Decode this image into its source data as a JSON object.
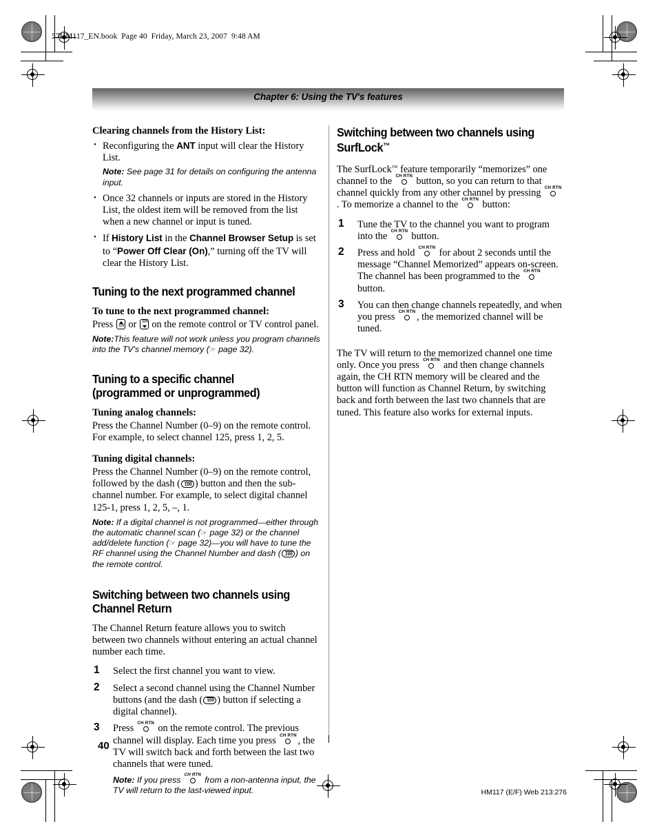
{
  "book_header": "57HM117_EN.book  Page 40  Friday, March 23, 2007  9:48 AM",
  "chapter_banner": {
    "title": "Chapter 6: Using the TV's features"
  },
  "left_column": {
    "history_heading": "Clearing channels from the History List:",
    "history_bullets": {
      "b1_pre": "Reconfiguring the ",
      "b1_bold": "ANT",
      "b1_post": " input will clear the History List.",
      "b1_note_label": "Note:",
      "b1_note_text": " See page 31 for details on configuring the antenna input.",
      "b2": "Once 32 channels or inputs are stored in the History List, the oldest item will be removed from the list when a new channel or input is tuned.",
      "b3_pre": "If ",
      "b3_bold1": "History List",
      "b3_mid1": " in the ",
      "b3_bold2": "Channel Browser Setup",
      "b3_mid2": " is set to “",
      "b3_bold3": "Power Off Clear (On)",
      "b3_post": ",” turning off the TV will clear the History List."
    },
    "section_next_channel": {
      "heading": "Tuning to the next programmed channel",
      "sub": "To tune to the next programmed channel:",
      "body_pre": "Press ",
      "body_mid": " or ",
      "body_post": " on the remote control or TV control panel.",
      "note_label": "Note:",
      "note_pre": "This feature will not work unless you program channels into the TV's channel memory (",
      "note_post": " page 32)."
    },
    "section_specific_channel": {
      "heading": "Tuning to a specific channel (programmed or unprogrammed)",
      "analog_sub": "Tuning analog channels:",
      "analog_body": "Press the Channel Number (0–9) on the remote control. For example, to select channel 125, press 1, 2, 5.",
      "digital_sub": "Tuning digital channels:",
      "digital_pre": "Press the Channel Number (0–9) on the remote control, followed by the dash (",
      "digital_post": ") button and then the sub-channel number. For example, to select digital channel 125-1, press 1, 2, 5, –, 1.",
      "digital_note_label": "Note:",
      "digital_note_p1": " If a digital channel is not programmed—either through the automatic channel scan (",
      "digital_note_p2": " page 32) or the channel add/delete function (",
      "digital_note_p3": " page 32)—you will have to tune the RF channel using the Channel Number and dash (",
      "digital_note_p4": ") on the remote control."
    },
    "section_channel_return": {
      "heading": "Switching between two channels using Channel Return",
      "intro": "The Channel Return feature allows you to switch between two channels without entering an actual channel number each time.",
      "steps": [
        {
          "num": "1",
          "text": "Select the first channel you want to view."
        },
        {
          "num": "2",
          "pre": "Select a second channel using the Channel Number buttons (and the dash (",
          "post": ") button if selecting a digital channel)."
        },
        {
          "num": "3",
          "pre": "Press ",
          "mid": " on the remote control. The previous channel will display. Each time you press ",
          "post": ", the TV will switch back and forth between the last two channels that were tuned.",
          "note_label": "Note:",
          "note_pre": " If you press ",
          "note_post": " from a non-antenna input, the TV will return to the last-viewed input."
        }
      ]
    }
  },
  "right_column": {
    "section_surflock": {
      "heading_line1": "Switching between two channels using",
      "heading_line2": "SurfLock",
      "heading_tm": "™",
      "intro_p1": "The SurfLock",
      "intro_tm": "™",
      "intro_p2": " feature temporarily “memorizes” one channel to the ",
      "intro_p3": " button, so you can return to that channel quickly from any other channel by pressing ",
      "intro_p4": ". To memorize a channel to the ",
      "intro_p5": " button:",
      "steps": [
        {
          "num": "1",
          "pre": "Tune the TV to the channel you want to program into the ",
          "post": " button."
        },
        {
          "num": "2",
          "pre": "Press and hold ",
          "mid": " for about 2 seconds until the message “Channel Memorized” appears on-screen. The channel has been programmed to the ",
          "post": " button."
        },
        {
          "num": "3",
          "pre": "You can then change channels repeatedly, and when you press ",
          "post": ", the memorized channel will be tuned."
        }
      ],
      "outro_pre": "The TV will return to the memorized channel one time only. Once you press ",
      "outro_post": " and then change channels again, the CH RTN memory will be cleared and the button will function as Channel Return, by switching back and forth between the last two channels that are tuned. This feature also works for external inputs."
    }
  },
  "footer": {
    "page_number": "40",
    "code": "HM117 (E/F) Web 213:276"
  },
  "icons": {
    "ch_rtn_caption": "CH RTN",
    "ch_label": "CH",
    "dash_label": "100",
    "hand_pointer": "☞"
  }
}
